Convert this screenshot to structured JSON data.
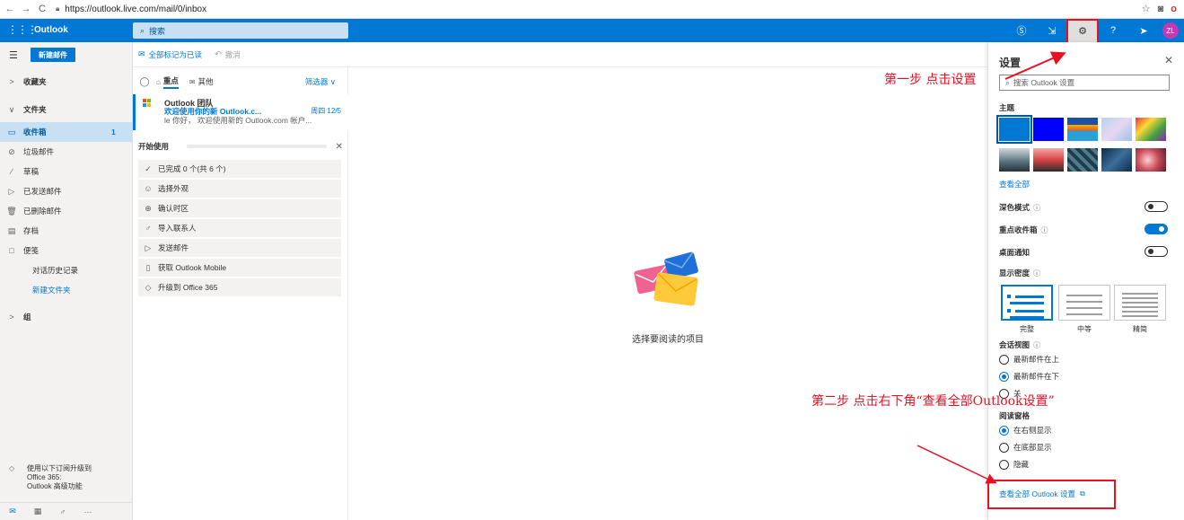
{
  "browser": {
    "back": "←",
    "forward": "→",
    "reload": "C",
    "url": "https://outlook.live.com/mail/0/inbox"
  },
  "topbar": {
    "brand": "Outlook",
    "search_placeholder": "搜索",
    "avatar_initials": "ZL"
  },
  "leftnav": {
    "new_mail": "新建邮件",
    "items": [
      {
        "label": "收藏夹",
        "icon": "chevron-right-icon"
      },
      {
        "label": "文件夹",
        "icon": "chevron-down-icon"
      },
      {
        "label": "收件箱",
        "icon": "inbox-icon",
        "count": "1"
      },
      {
        "label": "垃圾邮件",
        "icon": "junk-icon"
      },
      {
        "label": "草稿",
        "icon": "pencil-icon"
      },
      {
        "label": "已发送邮件",
        "icon": "send-icon"
      },
      {
        "label": "已删除邮件",
        "icon": "trash-icon"
      },
      {
        "label": "存档",
        "icon": "archive-icon"
      },
      {
        "label": "便笺",
        "icon": "note-icon"
      },
      {
        "label": "对话历史记录"
      },
      {
        "label": "新建文件夹"
      },
      {
        "label": "组",
        "icon": "chevron-right-icon"
      }
    ],
    "upgrade_line1": "使用以下订阅升级到",
    "upgrade_line2": "Office 365:",
    "upgrade_line3": "Outlook 高级功能"
  },
  "commandbar": {
    "mark_all_read": "全部标记为已读",
    "undo": "撤消"
  },
  "messagelist": {
    "focused": "重点",
    "other": "其他",
    "filter": "筛选器",
    "message": {
      "sender": "Outlook 团队",
      "subject": "欢迎使用你的新 Outlook.c...",
      "date": "周四 12/5",
      "preview": "le 你好， 欢迎使用新的 Outlook.com 帐户..."
    },
    "getting_started": {
      "title": "开始使用",
      "progress": 0,
      "items": [
        {
          "label": "已完成 0 个(共 6 个)",
          "icon": "check-icon"
        },
        {
          "label": "选择外观",
          "icon": "palette-icon"
        },
        {
          "label": "确认时区",
          "icon": "globe-icon"
        },
        {
          "label": "导入联系人",
          "icon": "people-icon"
        },
        {
          "label": "发送邮件",
          "icon": "send-icon"
        },
        {
          "label": "获取 Outlook Mobile",
          "icon": "phone-icon"
        },
        {
          "label": "升级到 Office 365",
          "icon": "diamond-icon"
        }
      ]
    }
  },
  "reading": {
    "empty_text": "选择要阅读的项目"
  },
  "settings": {
    "title": "设置",
    "search_placeholder": "搜索 Outlook 设置",
    "theme_label": "主题",
    "see_all": "查看全部",
    "dark_mode": "深色模式",
    "dark_mode_on": false,
    "focused_inbox": "重点收件箱",
    "focused_inbox_on": true,
    "desktop_notify": "桌面通知",
    "desktop_notify_on": false,
    "density_label": "显示密度",
    "density_options": [
      "完整",
      "中等",
      "精简"
    ],
    "conversation_label": "会话视图",
    "conversation_options": [
      "最新邮件在上",
      "最新邮件在下",
      "关"
    ],
    "conversation_selected": 1,
    "reading_pane_label": "阅读窗格",
    "reading_pane_options": [
      "在右侧显示",
      "在底部显示",
      "隐藏"
    ],
    "reading_pane_selected": 0,
    "view_all": "查看全部 Outlook 设置"
  },
  "annotations": {
    "step1": "第一步 点击设置",
    "step2": "第二步 点击右下角“查看全部Outlook设置”"
  },
  "colors": {
    "accent": "#0078d4",
    "annotation": "#e81123"
  }
}
